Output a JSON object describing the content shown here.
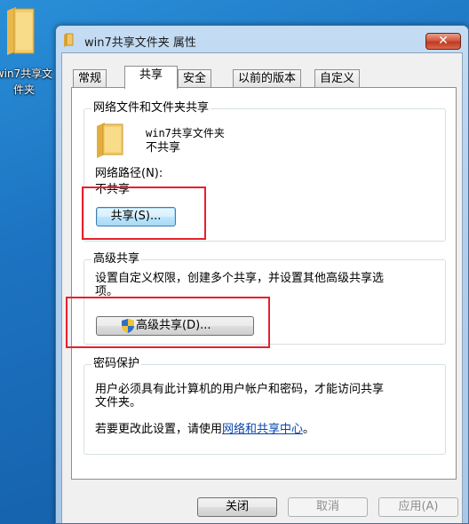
{
  "desktop": {
    "icon_label_line1": "win7共享文",
    "icon_label_line2": "件夹"
  },
  "window": {
    "title": "win7共享文件夹 属性",
    "close_glyph": "✕"
  },
  "tabs": [
    {
      "label": "常规"
    },
    {
      "label": "共享"
    },
    {
      "label": "安全"
    },
    {
      "label": "以前的版本"
    },
    {
      "label": "自定义"
    }
  ],
  "network_sharing": {
    "group_title": "网络文件和文件夹共享",
    "folder_name": "win7共享文件夹",
    "share_status": "不共享",
    "path_label": "网络路径(N):",
    "path_value": "不共享",
    "share_button": "共享(S)..."
  },
  "advanced_sharing": {
    "group_title": "高级共享",
    "description_line1": "设置自定义权限，创建多个共享，并设置其他高级共享选",
    "description_line2": "项。",
    "button": "高级共享(D)..."
  },
  "password": {
    "group_title": "密码保护",
    "text_line1": "用户必须具有此计算机的用户帐户和密码，才能访问共享",
    "text_line2": "文件夹。",
    "change_prefix": "若要更改此设置，请使用",
    "link": "网络和共享中心",
    "change_suffix": "。"
  },
  "buttons": {
    "close": "关闭",
    "cancel": "取消",
    "apply": "应用(A)"
  }
}
